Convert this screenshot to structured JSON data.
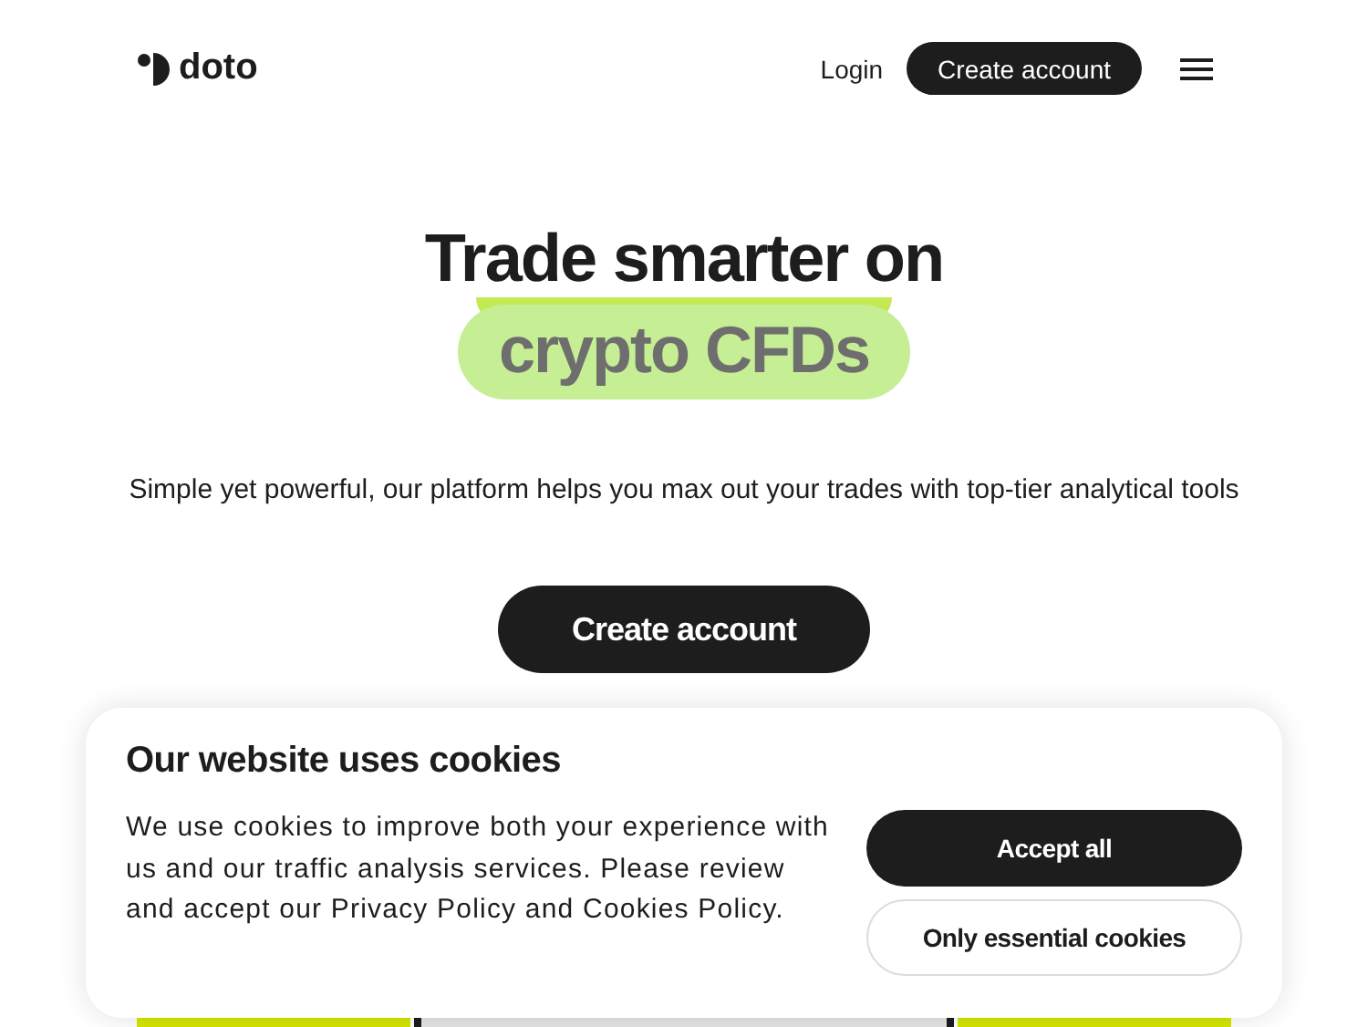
{
  "header": {
    "logo": "doto",
    "login": "Login",
    "create_account": "Create account"
  },
  "hero": {
    "title": "Trade smarter on",
    "highlight": "crypto CFDs",
    "subtitle": "Simple yet powerful, our platform helps you max out your trades with top-tier analytical tools",
    "cta": "Create account"
  },
  "cookie_banner": {
    "title": "Our website uses cookies",
    "text": "We use cookies to improve both your experience with us and our traffic analysis services. Please review and accept our Privacy Policy and Cookies Policy.",
    "buttons": [
      {
        "label": "Accept all",
        "kind": "primary"
      },
      {
        "label": "Only essential cookies",
        "kind": "secondary"
      }
    ]
  }
}
